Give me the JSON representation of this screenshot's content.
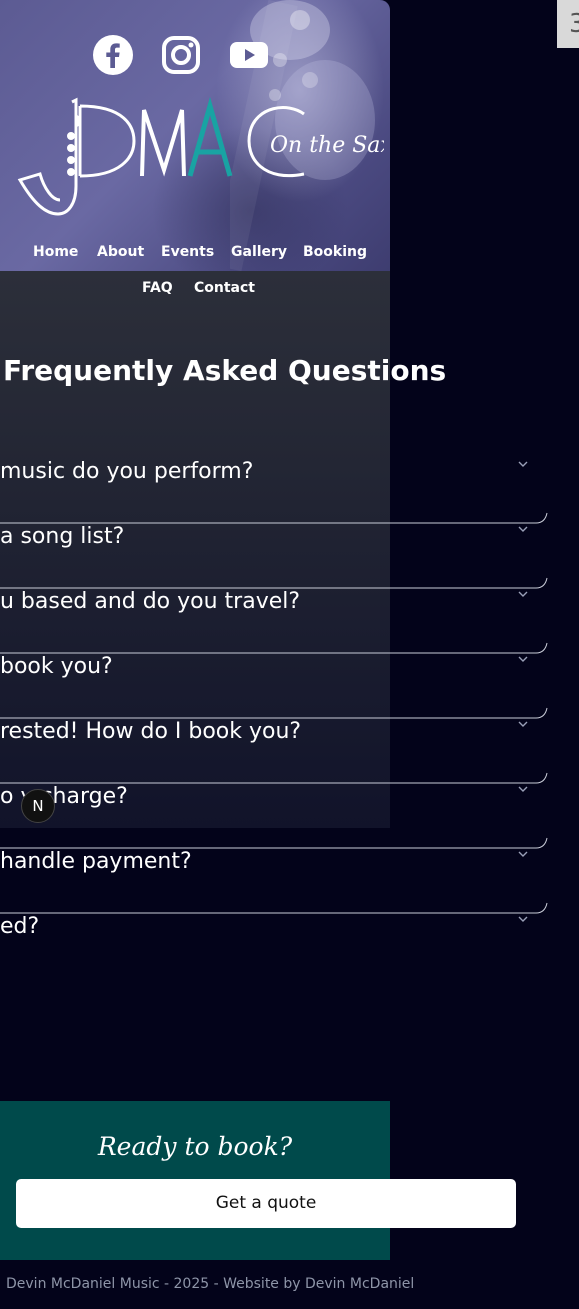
{
  "corner_tab": {
    "label": "3"
  },
  "social": [
    {
      "name": "facebook-icon"
    },
    {
      "name": "instagram-icon"
    },
    {
      "name": "youtube-icon"
    }
  ],
  "logo": {
    "brand": "DMAC",
    "tagline": "On the Sax"
  },
  "nav": {
    "row1": [
      "Home",
      "About",
      "Events",
      "Gallery",
      "Booking"
    ],
    "row2": [
      "FAQ",
      "Contact"
    ]
  },
  "faq": {
    "title": "Frequently Asked Questions",
    "items": [
      "music do you perform?",
      "a song list?",
      "u based and do you travel?",
      "book you?",
      "rested! How do I book you?",
      "o y   charge?",
      "handle payment?",
      "ed?"
    ]
  },
  "cta": {
    "title": "Ready to book?",
    "button": "Get a quote"
  },
  "footer": {
    "text": "Devin McDaniel Music - 2025 - Website by Devin McDaniel"
  },
  "badge": {
    "label": "N"
  },
  "colors": {
    "background": "#03031a",
    "hero": "#5c5b93",
    "accent_teal": "#19a3a3",
    "cta": "#004a4b",
    "footer_text": "#8e95a8"
  }
}
